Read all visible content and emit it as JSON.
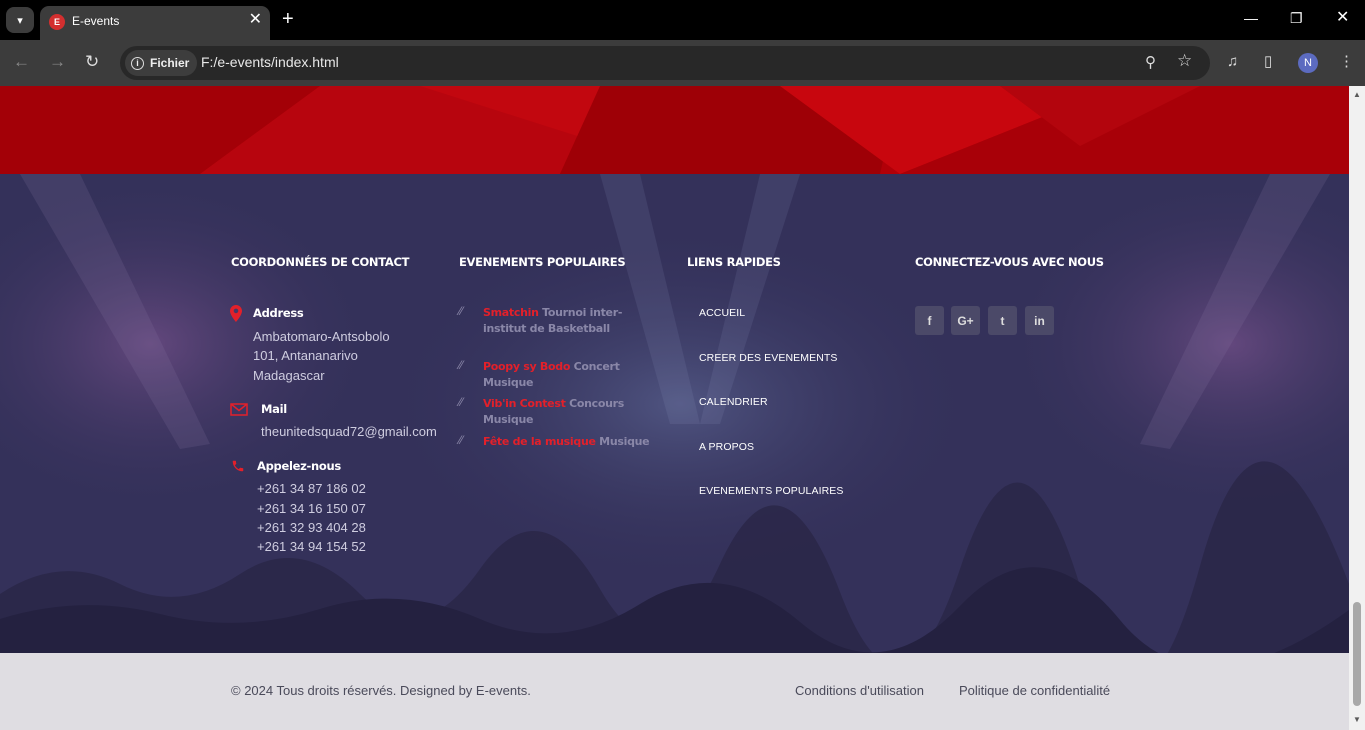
{
  "browser": {
    "tab_title": "E-events",
    "tab_favicon": "E",
    "tab_close": "✕",
    "new_tab": "+",
    "secure_chip": "Fichier",
    "url": "F:/e-events/index.html",
    "profile_initial": "N"
  },
  "footer": {
    "contact": {
      "title": "COORDONNÉES DE CONTACT",
      "address_label": "Address",
      "address_lines": [
        "Ambatomaro-Antsobolo",
        "101, Antananarivo",
        "Madagascar"
      ],
      "mail_label": "Mail",
      "mail": "theunitedsquad72@gmail.com",
      "phone_label": "Appelez-nous",
      "phones": [
        "+261 34 87 186 02",
        "+261 34 16 150 07",
        "+261 32 93 404 28",
        "+261 34 94 154 52"
      ]
    },
    "events": {
      "title": "EVENEMENTS POPULAIRES",
      "items": [
        {
          "name": "Smatchin",
          "desc": " Tournoi inter-institut de Basketball"
        },
        {
          "name": "Poopy sy Bodo",
          "desc": " Concert Musique"
        },
        {
          "name": "Vib'in Contest",
          "desc": " Concours Musique"
        },
        {
          "name": "Fête de la musique",
          "desc": " Musique"
        }
      ]
    },
    "quick_links": {
      "title": "LIENS RAPIDES",
      "items": [
        "ACCUEIL",
        "CREER DES EVENEMENTS",
        "CALENDRIER",
        "A PROPOS",
        "EVENEMENTS POPULAIRES"
      ]
    },
    "social": {
      "title": "CONNECTEZ-VOUS AVEC NOUS",
      "icons": [
        "f",
        "G+",
        "t",
        "in"
      ]
    },
    "bottom": {
      "copyright": "© 2024 Tous droits réservés. Designed by E-events.",
      "terms": "Conditions d'utilisation",
      "privacy": "Politique de confidentialité"
    }
  },
  "colors": {
    "accent_red": "#e3202a",
    "footer_bg": "#34315a",
    "bottom_bg": "#dfdde2"
  }
}
